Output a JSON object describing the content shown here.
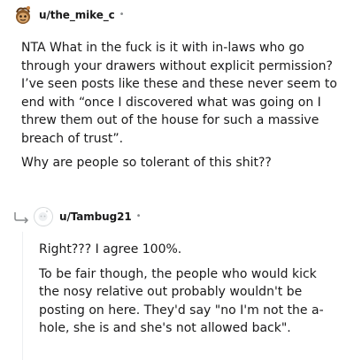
{
  "comments": [
    {
      "username": "u/the_mike_c",
      "dot": "•",
      "avatar": "snoo-avatar-icon",
      "paragraphs": [
        "NTA What in the fuck is it with in-laws who go through your drawers without explicit permission? I’ve seen posts like these and these never seem to end with “once I discovered what was going on I threw them out of the house for such a massive breach of trust”.",
        "Why are people so tolerant of this shit??"
      ]
    },
    {
      "username": "u/Tambug21",
      "dot": "•",
      "avatar": "default-avatar-icon",
      "reply_icon": "reply-arrow-icon",
      "paragraphs": [
        "Right??? I agree 100%.",
        "To be fair though, the people who would kick the nosy relative out probably wouldn't be posting on here. They'd say \"no I'm not the a-hole, she is and she's not allowed back\"."
      ]
    }
  ]
}
